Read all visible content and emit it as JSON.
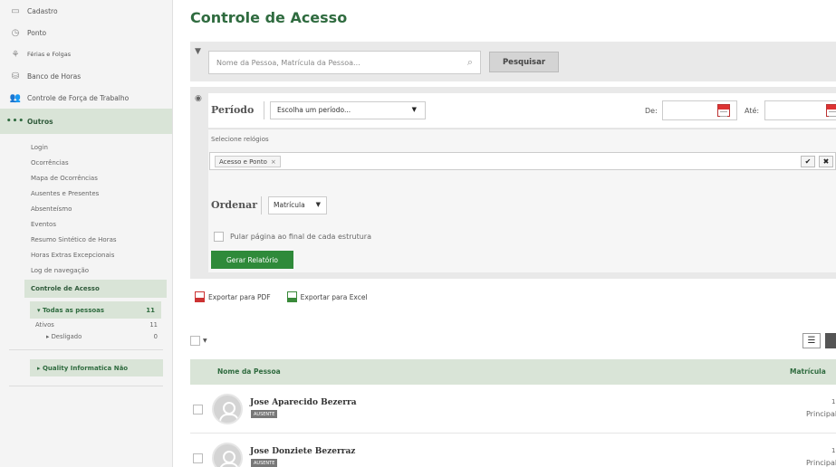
{
  "sidebar": {
    "items": [
      {
        "label": "Cadastro",
        "icon": "id-card-icon"
      },
      {
        "label": "Ponto",
        "icon": "clock-icon"
      },
      {
        "label": "Férias e Folgas",
        "icon": "palm-tree-icon"
      },
      {
        "label": "Banco de Horas",
        "icon": "database-clock-icon"
      },
      {
        "label": "Controle de Força de Trabalho",
        "icon": "users-icon"
      },
      {
        "label": "Outros",
        "icon": "dots-icon",
        "glyph": "•••"
      }
    ],
    "submenu": [
      "Login",
      "Ocorrências",
      "Mapa de Ocorrências",
      "Ausentes e Presentes",
      "Absenteísmo",
      "Eventos",
      "Resumo Sintético de Horas",
      "Horas Extras Excepcionais",
      "Log de navegação"
    ],
    "active_sub": "Controle de Acesso",
    "tree": {
      "head_label": "▾ Todas as pessoas",
      "head_count": "11",
      "ativos_label": "Ativos",
      "ativos_count": "11",
      "desligado_label": "▸ Desligado",
      "desligado_count": "0"
    },
    "quality_label": "▸ Quality Informatica Não"
  },
  "main": {
    "title": "Controle de Acesso",
    "search": {
      "placeholder": "Nome da Pessoa, Matrícula da Pessoa...",
      "button_label": "Pesquisar"
    },
    "periodo": {
      "label": "Período",
      "select_value": "Escolha um período...",
      "de_label": "De:",
      "ate_label": "Até:"
    },
    "relogios": {
      "label": "Selecione relógios",
      "tag": "Acesso e Ponto",
      "tag_remove": "×",
      "confirm_glyph": "✔",
      "clear_glyph": "✖"
    },
    "ordenar": {
      "label": "Ordenar",
      "select_value": "Matrícula",
      "checkbox_label": "Pular página ao final de cada estrutura",
      "button_label": "Gerar Relatório"
    },
    "export": {
      "pdf_label": "Exportar para PDF",
      "excel_label": "Exportar para Excel"
    },
    "table": {
      "col_nome": "Nome da Pessoa",
      "col_matricula": "Matrícula",
      "rows": [
        {
          "name": "Jose Aparecido Bezerra",
          "badge": "AUSENTE",
          "num": "1",
          "principal": "Principal"
        },
        {
          "name": "Jose Donziete Bezerraz",
          "badge": "AUSENTE",
          "num": "1",
          "principal": "Principal"
        }
      ]
    }
  },
  "colors": {
    "accent_green": "#2f6b3f",
    "button_green": "#2f8a3a",
    "highlight": "#d9e4d7"
  }
}
